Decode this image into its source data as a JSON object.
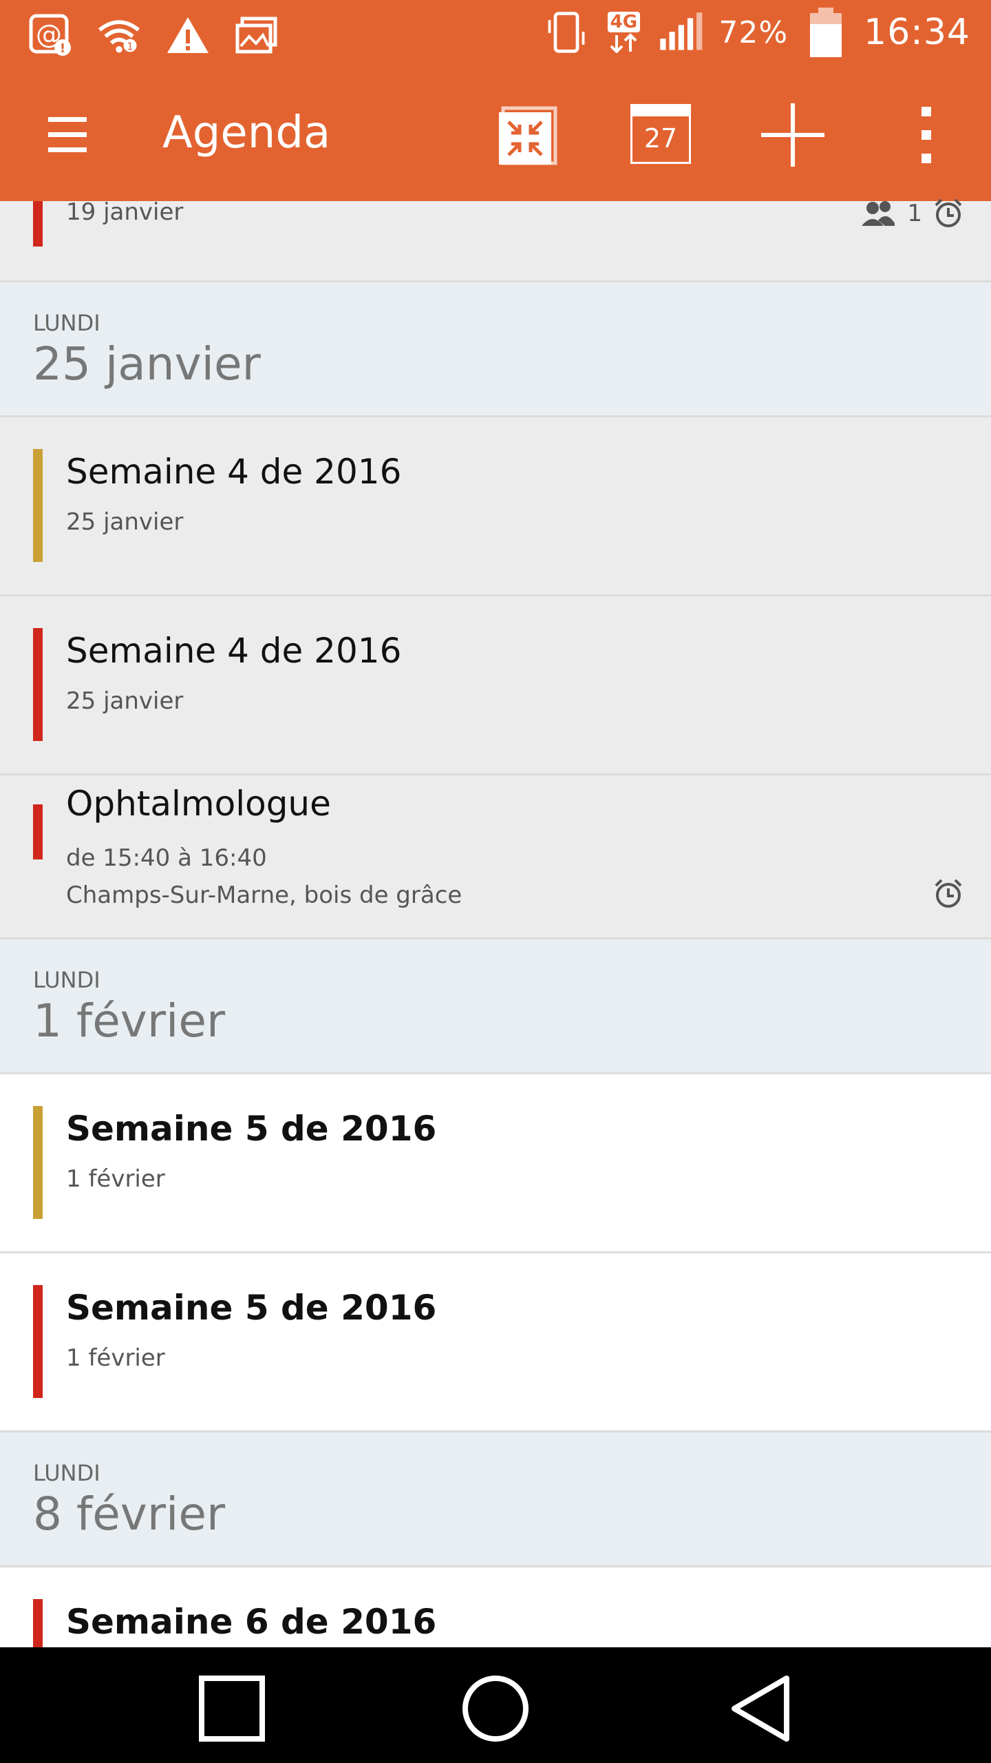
{
  "status_bar": {
    "battery_percent": "72%",
    "time": "16:34",
    "network_type": "4G",
    "icons": [
      "at-alert-icon",
      "wifi-icon",
      "warning-icon",
      "gallery-icon",
      "vibrate-icon",
      "data-arrows-icon",
      "signal-icon",
      "battery-icon"
    ]
  },
  "toolbar": {
    "title": "Agenda",
    "calendar_day": "27",
    "colors": {
      "accent": "#e36330"
    }
  },
  "list": {
    "top_event": {
      "date": "19 janvier",
      "attendee_count": "1"
    },
    "sections": [
      {
        "day": "LUNDI",
        "date": "25 janvier",
        "events": [
          {
            "title": "Semaine 4 de 2016",
            "subtitle": "25 janvier",
            "color": "#c9a035"
          },
          {
            "title": "Semaine 4 de 2016",
            "subtitle": "25 janvier",
            "color": "#d0271d"
          },
          {
            "title": "Ophtalmologue",
            "time": "de 15:40 à 16:40",
            "location": "Champs-Sur-Marne, bois de grâce",
            "color": "#d0271d"
          }
        ]
      },
      {
        "day": "LUNDI",
        "date": "1 février",
        "events": [
          {
            "title": "Semaine 5 de 2016",
            "subtitle": "1 février",
            "color": "#c9a035"
          },
          {
            "title": "Semaine 5 de 2016",
            "subtitle": "1 février",
            "color": "#d0271d"
          }
        ]
      },
      {
        "day": "LUNDI",
        "date": "8 février",
        "events": [
          {
            "title": "Semaine 6 de 2016",
            "color": "#d0271d"
          }
        ]
      }
    ]
  }
}
